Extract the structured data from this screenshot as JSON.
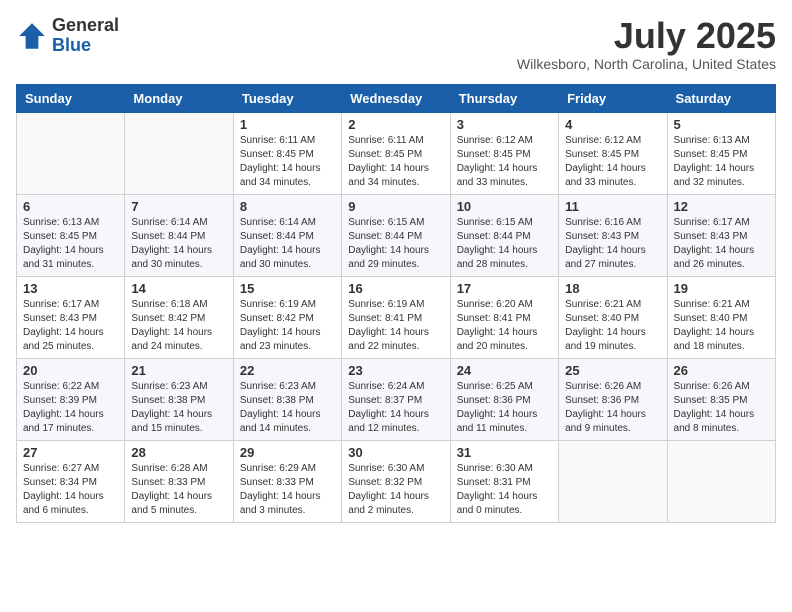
{
  "logo": {
    "general": "General",
    "blue": "Blue"
  },
  "header": {
    "month": "July 2025",
    "location": "Wilkesboro, North Carolina, United States"
  },
  "days_of_week": [
    "Sunday",
    "Monday",
    "Tuesday",
    "Wednesday",
    "Thursday",
    "Friday",
    "Saturday"
  ],
  "weeks": [
    [
      {
        "day": "",
        "info": ""
      },
      {
        "day": "",
        "info": ""
      },
      {
        "day": "1",
        "info": "Sunrise: 6:11 AM\nSunset: 8:45 PM\nDaylight: 14 hours and 34 minutes."
      },
      {
        "day": "2",
        "info": "Sunrise: 6:11 AM\nSunset: 8:45 PM\nDaylight: 14 hours and 34 minutes."
      },
      {
        "day": "3",
        "info": "Sunrise: 6:12 AM\nSunset: 8:45 PM\nDaylight: 14 hours and 33 minutes."
      },
      {
        "day": "4",
        "info": "Sunrise: 6:12 AM\nSunset: 8:45 PM\nDaylight: 14 hours and 33 minutes."
      },
      {
        "day": "5",
        "info": "Sunrise: 6:13 AM\nSunset: 8:45 PM\nDaylight: 14 hours and 32 minutes."
      }
    ],
    [
      {
        "day": "6",
        "info": "Sunrise: 6:13 AM\nSunset: 8:45 PM\nDaylight: 14 hours and 31 minutes."
      },
      {
        "day": "7",
        "info": "Sunrise: 6:14 AM\nSunset: 8:44 PM\nDaylight: 14 hours and 30 minutes."
      },
      {
        "day": "8",
        "info": "Sunrise: 6:14 AM\nSunset: 8:44 PM\nDaylight: 14 hours and 30 minutes."
      },
      {
        "day": "9",
        "info": "Sunrise: 6:15 AM\nSunset: 8:44 PM\nDaylight: 14 hours and 29 minutes."
      },
      {
        "day": "10",
        "info": "Sunrise: 6:15 AM\nSunset: 8:44 PM\nDaylight: 14 hours and 28 minutes."
      },
      {
        "day": "11",
        "info": "Sunrise: 6:16 AM\nSunset: 8:43 PM\nDaylight: 14 hours and 27 minutes."
      },
      {
        "day": "12",
        "info": "Sunrise: 6:17 AM\nSunset: 8:43 PM\nDaylight: 14 hours and 26 minutes."
      }
    ],
    [
      {
        "day": "13",
        "info": "Sunrise: 6:17 AM\nSunset: 8:43 PM\nDaylight: 14 hours and 25 minutes."
      },
      {
        "day": "14",
        "info": "Sunrise: 6:18 AM\nSunset: 8:42 PM\nDaylight: 14 hours and 24 minutes."
      },
      {
        "day": "15",
        "info": "Sunrise: 6:19 AM\nSunset: 8:42 PM\nDaylight: 14 hours and 23 minutes."
      },
      {
        "day": "16",
        "info": "Sunrise: 6:19 AM\nSunset: 8:41 PM\nDaylight: 14 hours and 22 minutes."
      },
      {
        "day": "17",
        "info": "Sunrise: 6:20 AM\nSunset: 8:41 PM\nDaylight: 14 hours and 20 minutes."
      },
      {
        "day": "18",
        "info": "Sunrise: 6:21 AM\nSunset: 8:40 PM\nDaylight: 14 hours and 19 minutes."
      },
      {
        "day": "19",
        "info": "Sunrise: 6:21 AM\nSunset: 8:40 PM\nDaylight: 14 hours and 18 minutes."
      }
    ],
    [
      {
        "day": "20",
        "info": "Sunrise: 6:22 AM\nSunset: 8:39 PM\nDaylight: 14 hours and 17 minutes."
      },
      {
        "day": "21",
        "info": "Sunrise: 6:23 AM\nSunset: 8:38 PM\nDaylight: 14 hours and 15 minutes."
      },
      {
        "day": "22",
        "info": "Sunrise: 6:23 AM\nSunset: 8:38 PM\nDaylight: 14 hours and 14 minutes."
      },
      {
        "day": "23",
        "info": "Sunrise: 6:24 AM\nSunset: 8:37 PM\nDaylight: 14 hours and 12 minutes."
      },
      {
        "day": "24",
        "info": "Sunrise: 6:25 AM\nSunset: 8:36 PM\nDaylight: 14 hours and 11 minutes."
      },
      {
        "day": "25",
        "info": "Sunrise: 6:26 AM\nSunset: 8:36 PM\nDaylight: 14 hours and 9 minutes."
      },
      {
        "day": "26",
        "info": "Sunrise: 6:26 AM\nSunset: 8:35 PM\nDaylight: 14 hours and 8 minutes."
      }
    ],
    [
      {
        "day": "27",
        "info": "Sunrise: 6:27 AM\nSunset: 8:34 PM\nDaylight: 14 hours and 6 minutes."
      },
      {
        "day": "28",
        "info": "Sunrise: 6:28 AM\nSunset: 8:33 PM\nDaylight: 14 hours and 5 minutes."
      },
      {
        "day": "29",
        "info": "Sunrise: 6:29 AM\nSunset: 8:33 PM\nDaylight: 14 hours and 3 minutes."
      },
      {
        "day": "30",
        "info": "Sunrise: 6:30 AM\nSunset: 8:32 PM\nDaylight: 14 hours and 2 minutes."
      },
      {
        "day": "31",
        "info": "Sunrise: 6:30 AM\nSunset: 8:31 PM\nDaylight: 14 hours and 0 minutes."
      },
      {
        "day": "",
        "info": ""
      },
      {
        "day": "",
        "info": ""
      }
    ]
  ]
}
